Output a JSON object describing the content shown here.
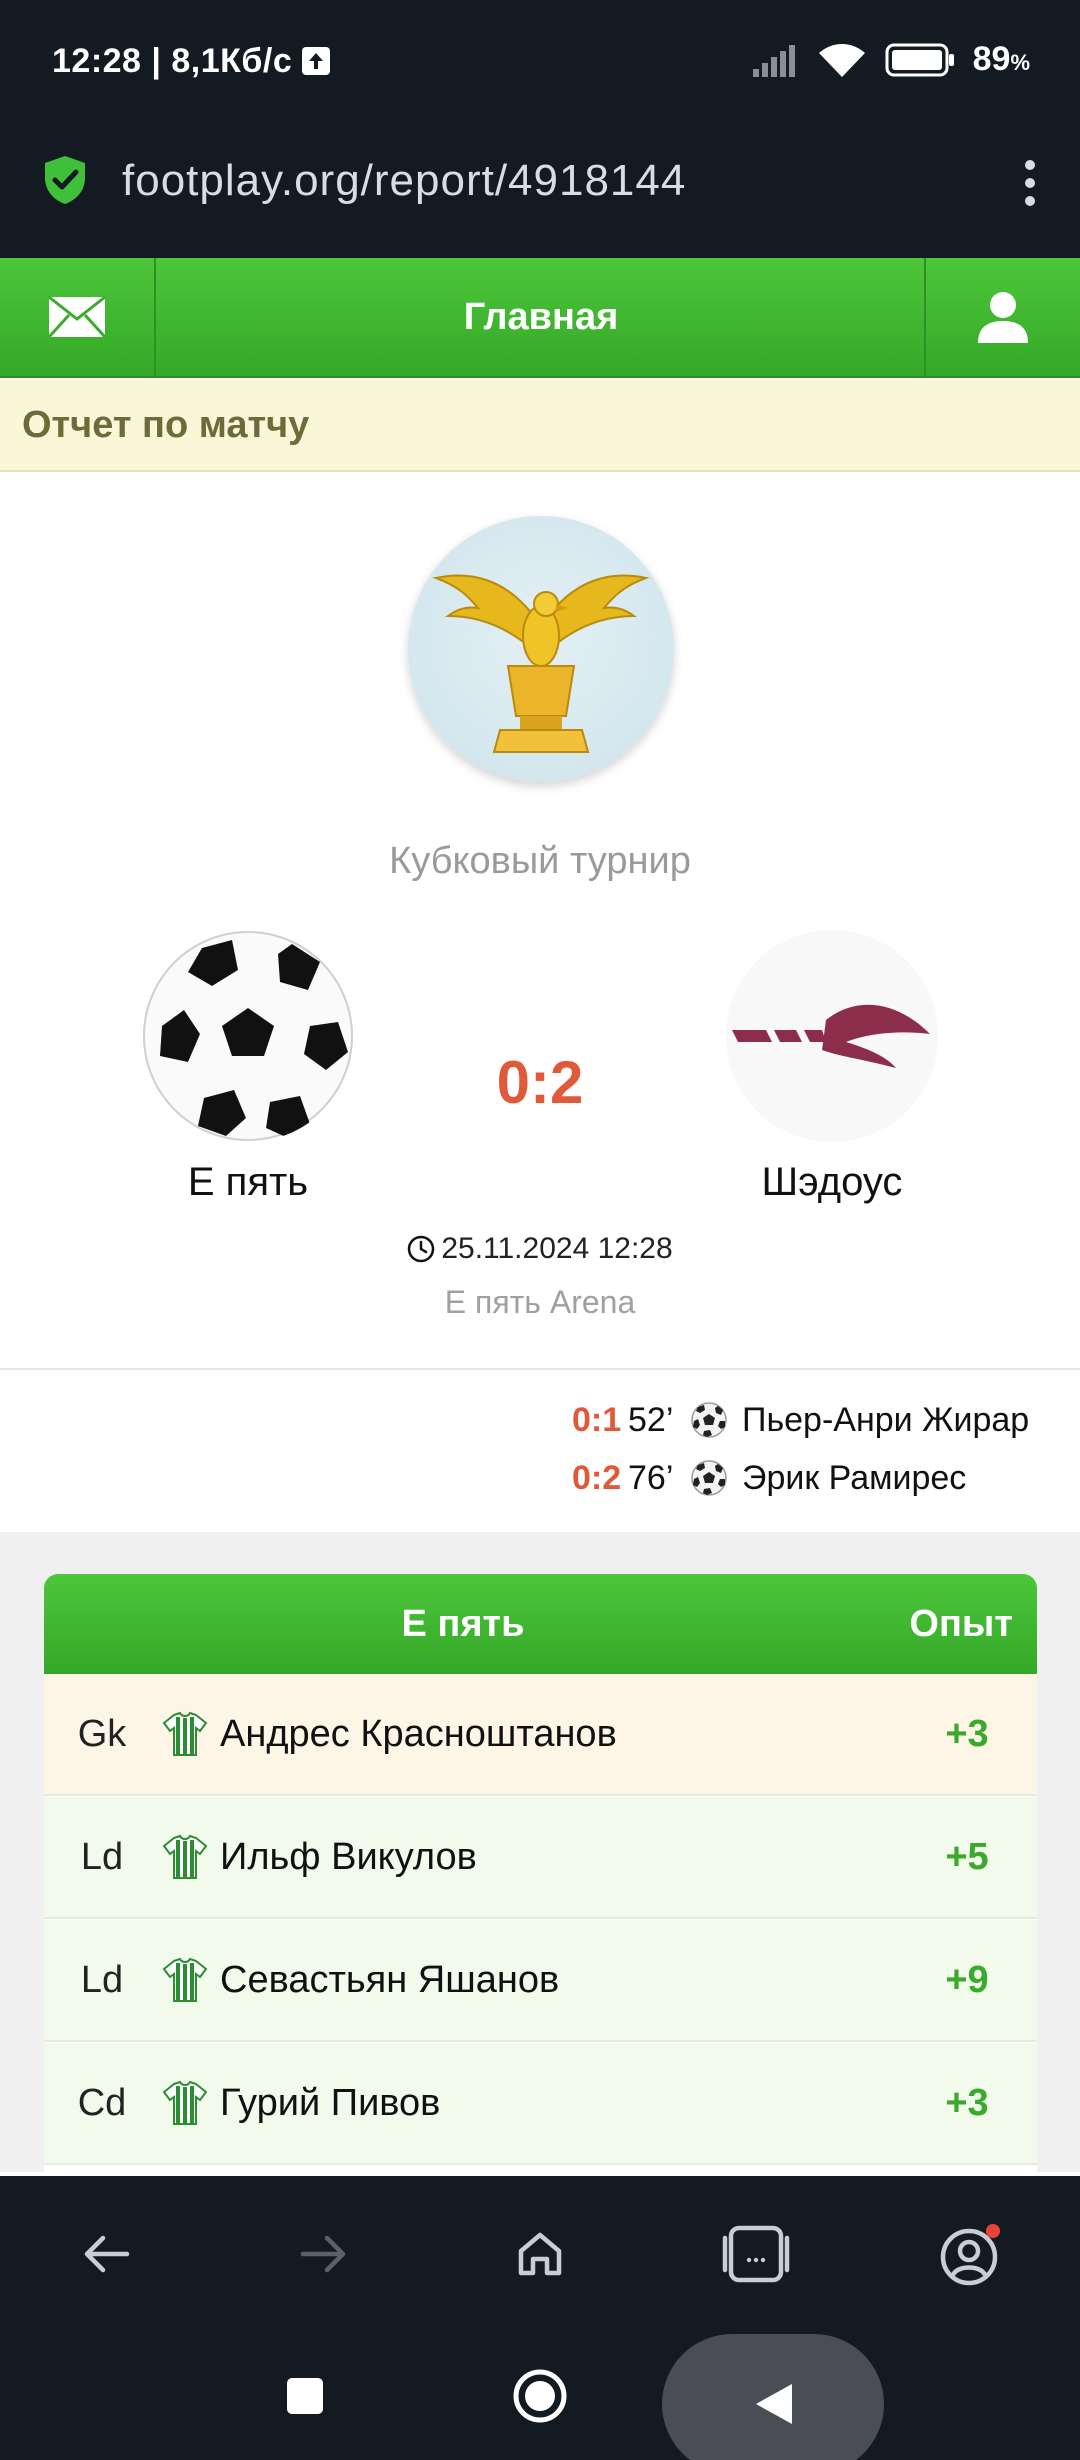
{
  "status_bar": {
    "time": "12:28 | 8,1Кб/с",
    "battery": "89",
    "battery_unit": "%"
  },
  "browser": {
    "url": "footplay.org/report/4918144"
  },
  "header": {
    "title": "Главная"
  },
  "page": {
    "heading": "Отчет по матчу"
  },
  "match": {
    "tournament": "Кубковый турнир",
    "home_team": "Е пять",
    "away_team": "Шэдоус",
    "score": "0:2",
    "datetime": "25.11.2024 12:28",
    "stadium": "Е пять Arena"
  },
  "goals": [
    {
      "score": "0:1",
      "minute": "52’",
      "player": "Пьер-Анри Жирар"
    },
    {
      "score": "0:2",
      "minute": "76’",
      "player": "Эрик Рамирес"
    }
  ],
  "lineup": {
    "team": "Е пять",
    "exp_header": "Опыт",
    "rows": [
      {
        "pos": "Gk",
        "name": "Андрес Красноштанов",
        "exp": "+3",
        "bg": "#fdf6e7"
      },
      {
        "pos": "Ld",
        "name": "Ильф Викулов",
        "exp": "+5",
        "bg": "#f1faeb"
      },
      {
        "pos": "Ld",
        "name": "Севастьян Яшанов",
        "exp": "+9",
        "bg": "#f1faeb"
      },
      {
        "pos": "Cd",
        "name": "Гурий Пивов",
        "exp": "+3",
        "bg": "#f1faeb"
      }
    ]
  },
  "colors": {
    "accent_green": "#3fb830",
    "score_red": "#e05a3a",
    "exp_green": "#3aa92c"
  },
  "icons": {
    "status": [
      "upload-icon",
      "signal-icon",
      "wifi-icon",
      "battery-icon"
    ],
    "browser_nav": [
      "back-arrow-icon",
      "forward-arrow-icon",
      "home-icon",
      "tabs-icon",
      "account-icon"
    ],
    "system_nav": [
      "recents-square-icon",
      "home-circle-icon",
      "back-triangle-icon"
    ]
  }
}
